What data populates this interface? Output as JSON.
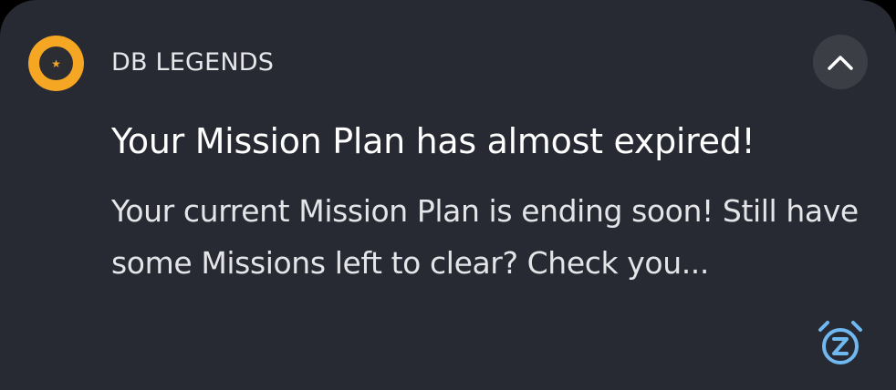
{
  "notification": {
    "app_name": "DB LEGENDS",
    "title": "Your Mission Plan has almost expired!",
    "body": "Your current Mission Plan is ending soon! Still have some Missions left to clear? Check you...",
    "icons": {
      "app": "db-legends-app-icon",
      "collapse": "chevron-up-icon",
      "snooze": "snooze-alarm-icon"
    },
    "colors": {
      "background": "#272a32",
      "app_icon_accent": "#f5a623",
      "snooze_accent": "#6fb8f0"
    }
  }
}
